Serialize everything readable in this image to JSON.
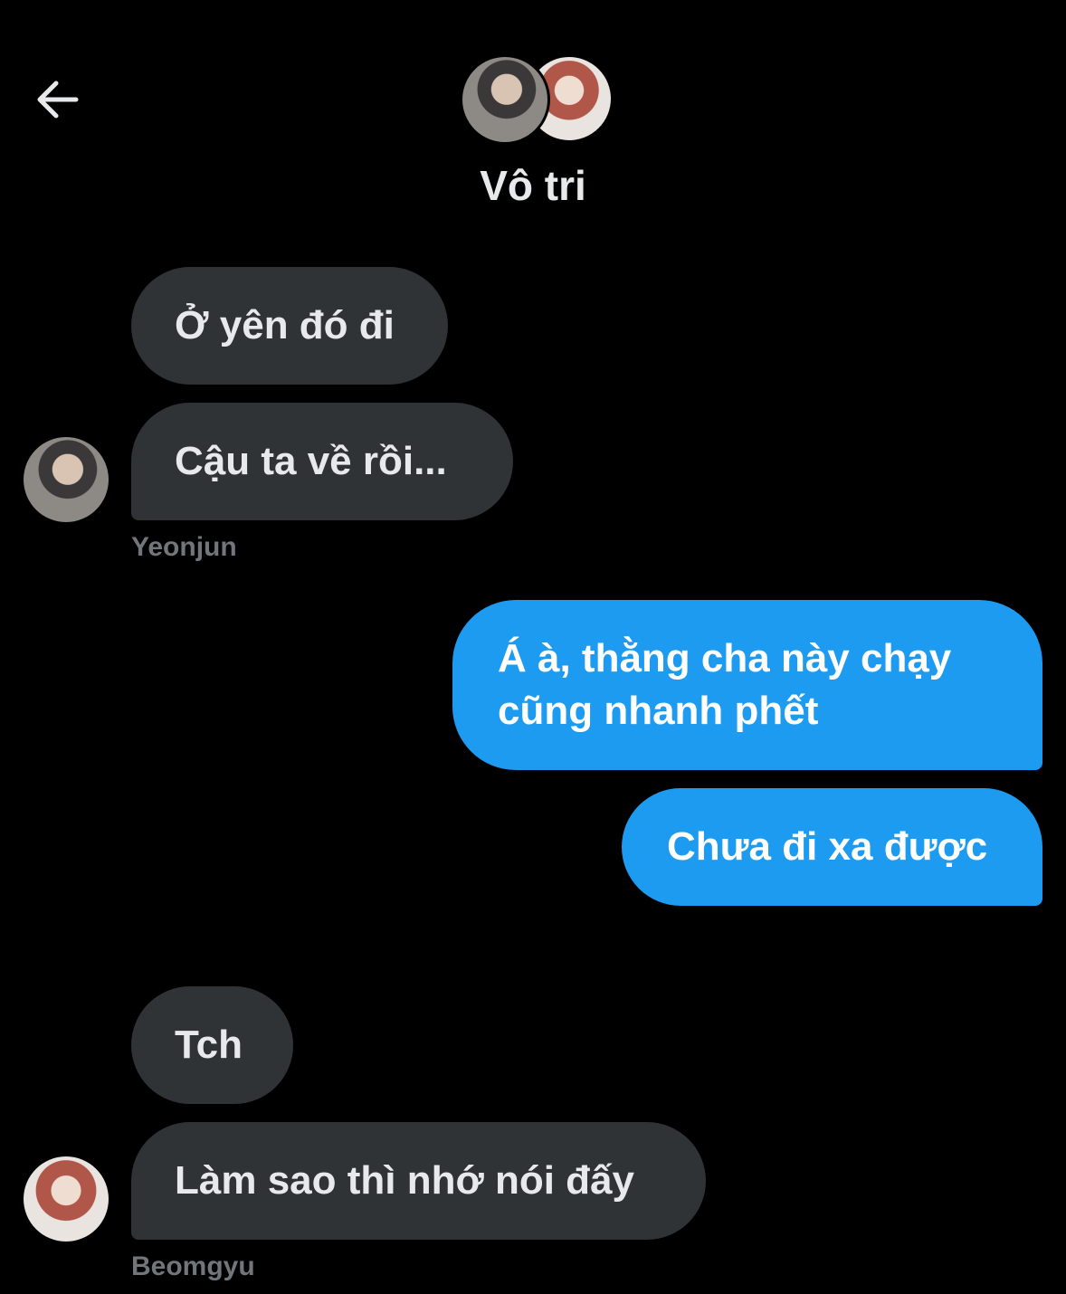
{
  "header": {
    "back_icon": "arrow-left-icon",
    "title": "Vô tri",
    "avatars": [
      "avatar-yeonjun",
      "avatar-beomgyu"
    ]
  },
  "messages": [
    {
      "sender": "Yeonjun",
      "direction": "incoming",
      "text": "Ở yên đó đi"
    },
    {
      "sender": "Yeonjun",
      "direction": "incoming",
      "text": "Cậu ta về rồi..."
    },
    {
      "sender": "me",
      "direction": "outgoing",
      "text": "Á à, thằng cha này chạy cũng nhanh phết"
    },
    {
      "sender": "me",
      "direction": "outgoing",
      "text": "Chưa đi xa được"
    },
    {
      "sender": "Beomgyu",
      "direction": "incoming",
      "text": "Tch"
    },
    {
      "sender": "Beomgyu",
      "direction": "incoming",
      "text": "Làm sao thì nhớ nói đấy"
    }
  ],
  "sender_labels": {
    "yeonjun": "Yeonjun",
    "beomgyu": "Beomgyu"
  },
  "colors": {
    "background": "#000000",
    "incoming_bubble": "#2f3336",
    "outgoing_bubble": "#1d9bf0",
    "muted_text": "#71767b"
  }
}
